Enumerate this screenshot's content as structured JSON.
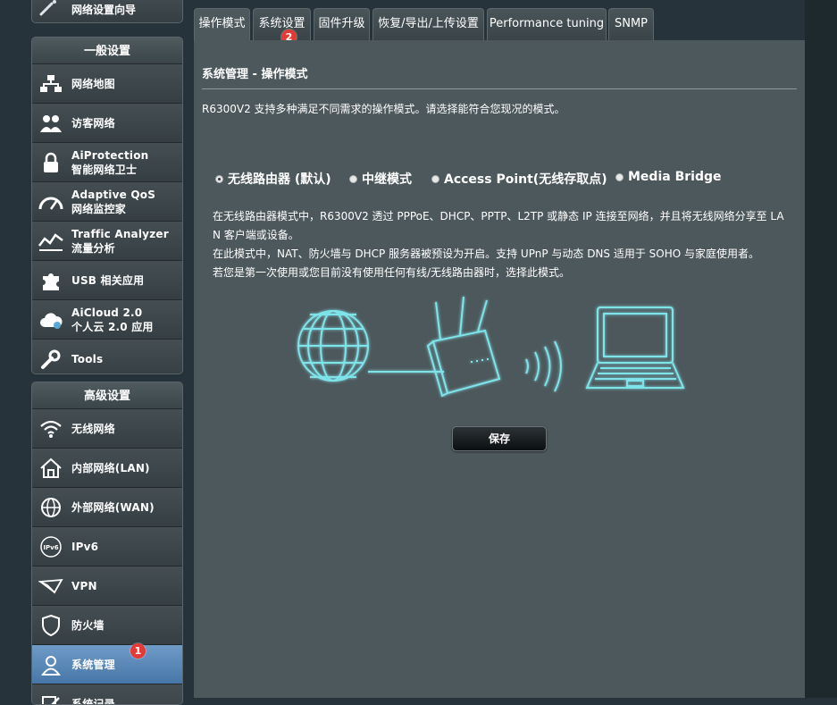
{
  "sidebar": {
    "top_item": "网络设置向导",
    "general_header": "一般设置",
    "general_items": [
      {
        "line1": "网络地图",
        "line2": "",
        "icon": "network-map-icon"
      },
      {
        "line1": "访客网络",
        "line2": "",
        "icon": "guest-network-icon"
      },
      {
        "line1": "AiProtection",
        "line2": "智能网络卫士",
        "icon": "lock-icon"
      },
      {
        "line1": "Adaptive QoS",
        "line2": "网络监控家",
        "icon": "gauge-icon"
      },
      {
        "line1": "Traffic Analyzer",
        "line2": "流量分析",
        "icon": "traffic-chart-icon"
      },
      {
        "line1": "USB 相关应用",
        "line2": "",
        "icon": "puzzle-icon"
      },
      {
        "line1": "AiCloud 2.0",
        "line2": "个人云 2.0 应用",
        "icon": "cloud-icon"
      },
      {
        "line1": "Tools",
        "line2": "",
        "icon": "wrench-icon"
      }
    ],
    "advanced_header": "高级设置",
    "advanced_items": [
      {
        "line1": "无线网络",
        "icon": "wifi-icon"
      },
      {
        "line1": "内部网络(LAN)",
        "icon": "home-icon"
      },
      {
        "line1": "外部网络(WAN)",
        "icon": "globe-icon"
      },
      {
        "line1": "IPv6",
        "icon": "ipv6-icon"
      },
      {
        "line1": "VPN",
        "icon": "vpn-icon"
      },
      {
        "line1": "防火墙",
        "icon": "shield-icon"
      },
      {
        "line1": "系统管理",
        "icon": "admin-user-icon",
        "active": true
      },
      {
        "line1": "系统记录",
        "icon": "log-edit-icon"
      }
    ],
    "annotation_badge": "1"
  },
  "tabs": [
    {
      "label": "操作模式",
      "active": true
    },
    {
      "label": "系统设置"
    },
    {
      "label": "固件升级"
    },
    {
      "label": "恢复/导出/上传设置"
    },
    {
      "label": "Performance tuning"
    },
    {
      "label": "SNMP"
    }
  ],
  "tab_badge": "2",
  "main": {
    "title": "系统管理 - 操作模式",
    "description": "R6300V2 支持多种满足不同需求的操作模式。请选择能符合您现况的模式。",
    "modes": [
      {
        "label": "无线路由器 (默认)",
        "checked": true
      },
      {
        "label": "中继模式",
        "checked": false
      },
      {
        "label": "Access Point(无线存取点)",
        "checked": false
      },
      {
        "label": "Media Bridge",
        "checked": false
      }
    ],
    "info_lines": [
      "在无线路由器模式中，R6300V2 透过 PPPoE、DHCP、PPTP、L2TP 或静态 IP 连接至网络，并且将无线网络分享至 LA",
      "N 客户端或设备。",
      "在此模式中，NAT、防火墙与 DHCP 服务器被预设为开启。支持 UPnP 与动态 DNS 适用于 SOHO 与家庭使用者。",
      "若您是第一次使用或您目前没有使用任何有线/无线路由器时，选择此模式。"
    ],
    "save_label": "保存"
  },
  "colors": {
    "panel_bg": "#4d585c",
    "page_bg": "#26333a",
    "active_menu": "#5a88b8",
    "badge": "#e53935",
    "illustration_glow": "#7fe3ea"
  }
}
